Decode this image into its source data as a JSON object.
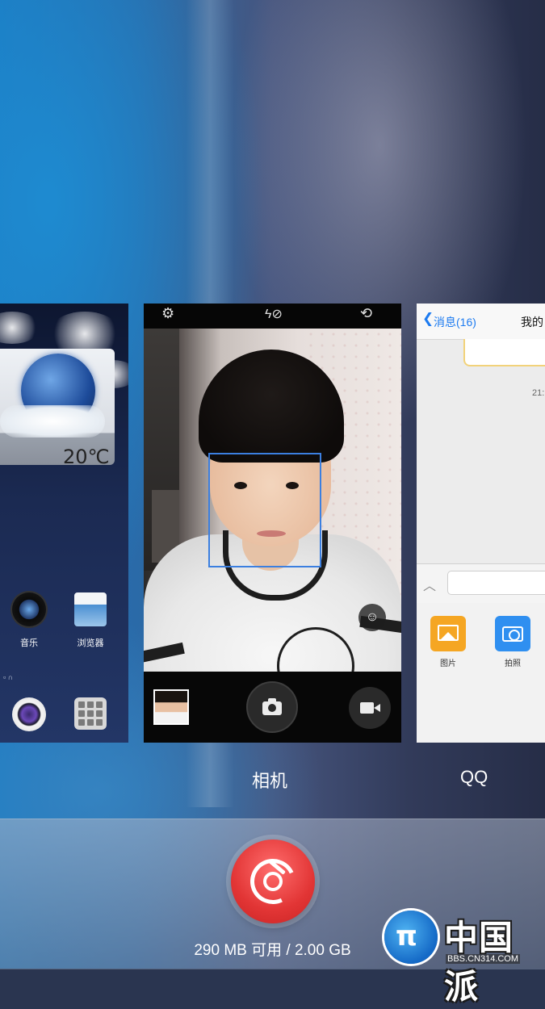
{
  "recents": {
    "cards": [
      {
        "id": "launcher",
        "weather": {
          "temperature": "20℃"
        },
        "dock_apps": [
          {
            "label": "音乐",
            "icon": "music-icon"
          },
          {
            "label": "浏览器",
            "icon": "browser-icon"
          }
        ],
        "bottom_apps": [
          {
            "icon": "camera-lens-icon"
          },
          {
            "icon": "apps-grid-icon"
          }
        ]
      },
      {
        "id": "camera",
        "title": "相机",
        "top_icons": [
          "settings-gear-icon",
          "flash-off-icon",
          "switch-camera-icon"
        ],
        "controls": [
          "gallery-thumbnail",
          "shutter-camera-icon",
          "video-record-icon"
        ],
        "face_detected": true,
        "beauty_mode_icon": "beauty-robot-icon"
      },
      {
        "id": "qq",
        "title": "QQ",
        "header": {
          "back_label": "消息(16)",
          "chat_title": "我的"
        },
        "message_time": "21:",
        "panel": [
          {
            "label": "图片",
            "icon": "photo-icon"
          },
          {
            "label": "拍照",
            "icon": "camera-icon"
          }
        ]
      }
    ],
    "accent_colors": {
      "clean_button": "#e23535",
      "qq_blue": "#1d7bf0",
      "face_box": "#3b7fe0"
    }
  },
  "memory": {
    "text": "290 MB 可用 / 2.00 GB"
  },
  "watermark": {
    "brand": "中国派",
    "url": "BBS.CN314.COM"
  }
}
